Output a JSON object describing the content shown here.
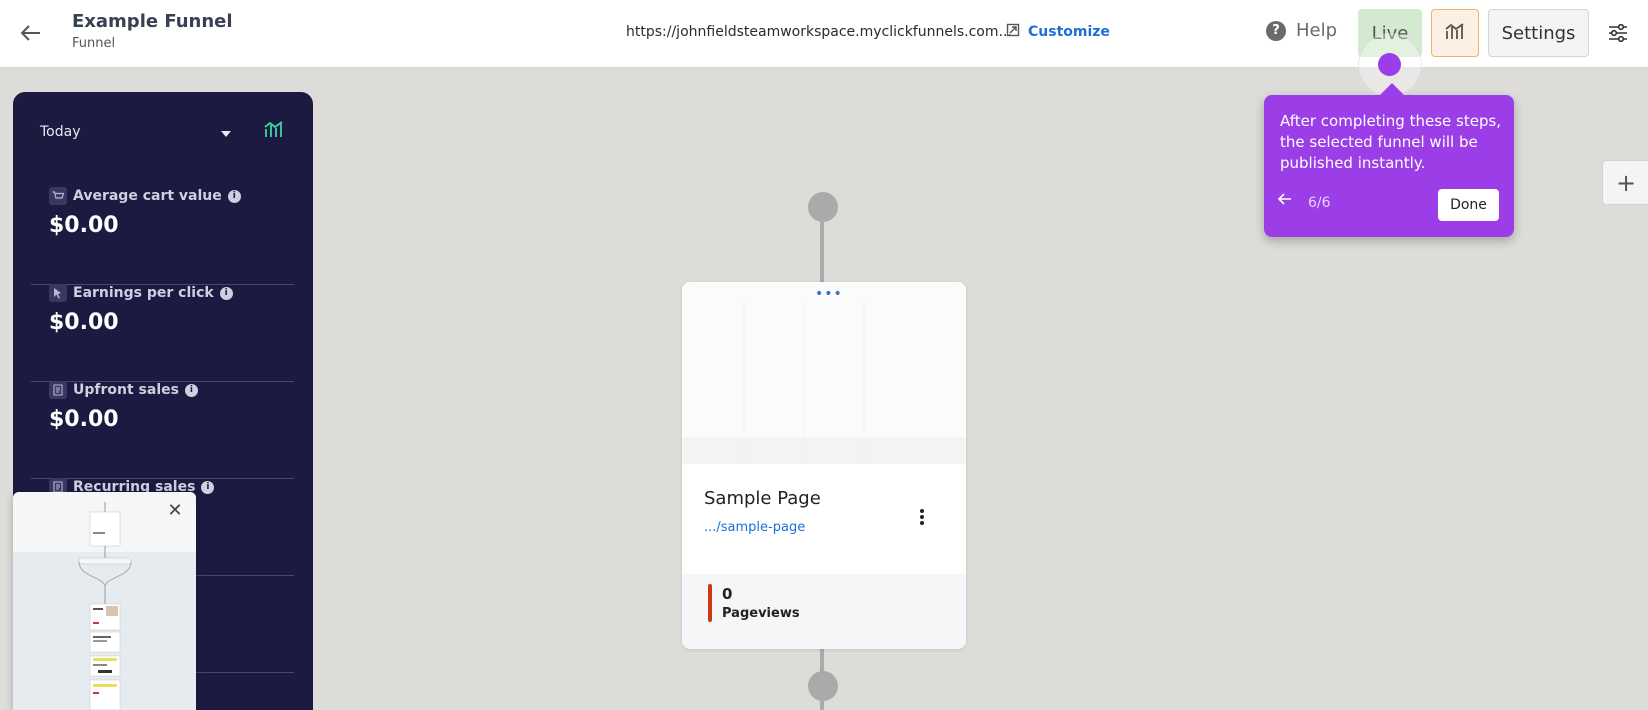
{
  "header": {
    "title": "Example Funnel",
    "subtitle": "Funnel",
    "url": "https://johnfieldsteamworkspace.myclickfunnels.com...",
    "customize_label": "Customize",
    "help_label": "Help",
    "live_label": "Live",
    "settings_label": "Settings"
  },
  "tour": {
    "text": "After completing these steps, the selected funnel will be published instantly.",
    "step": "6/6",
    "done_label": "Done",
    "accent": "#9b3ee8"
  },
  "stats_panel": {
    "range": "Today",
    "metrics": [
      {
        "label": "Average cart value",
        "value": "$0.00",
        "icon": "cart-icon"
      },
      {
        "label": "Earnings per click",
        "value": "$0.00",
        "icon": "cursor-icon"
      },
      {
        "label": "Upfront sales",
        "value": "$0.00",
        "icon": "receipt-icon"
      },
      {
        "label": "Recurring sales",
        "value": "",
        "icon": "receipt-icon"
      }
    ]
  },
  "page_card": {
    "name": "Sample Page",
    "path": ".../sample-page",
    "pageviews": "0",
    "pageviews_label": "Pageviews"
  },
  "colors": {
    "panel_bg": "#1c1a40",
    "live_bg": "#d4ead0",
    "link": "#1e6fd9"
  }
}
